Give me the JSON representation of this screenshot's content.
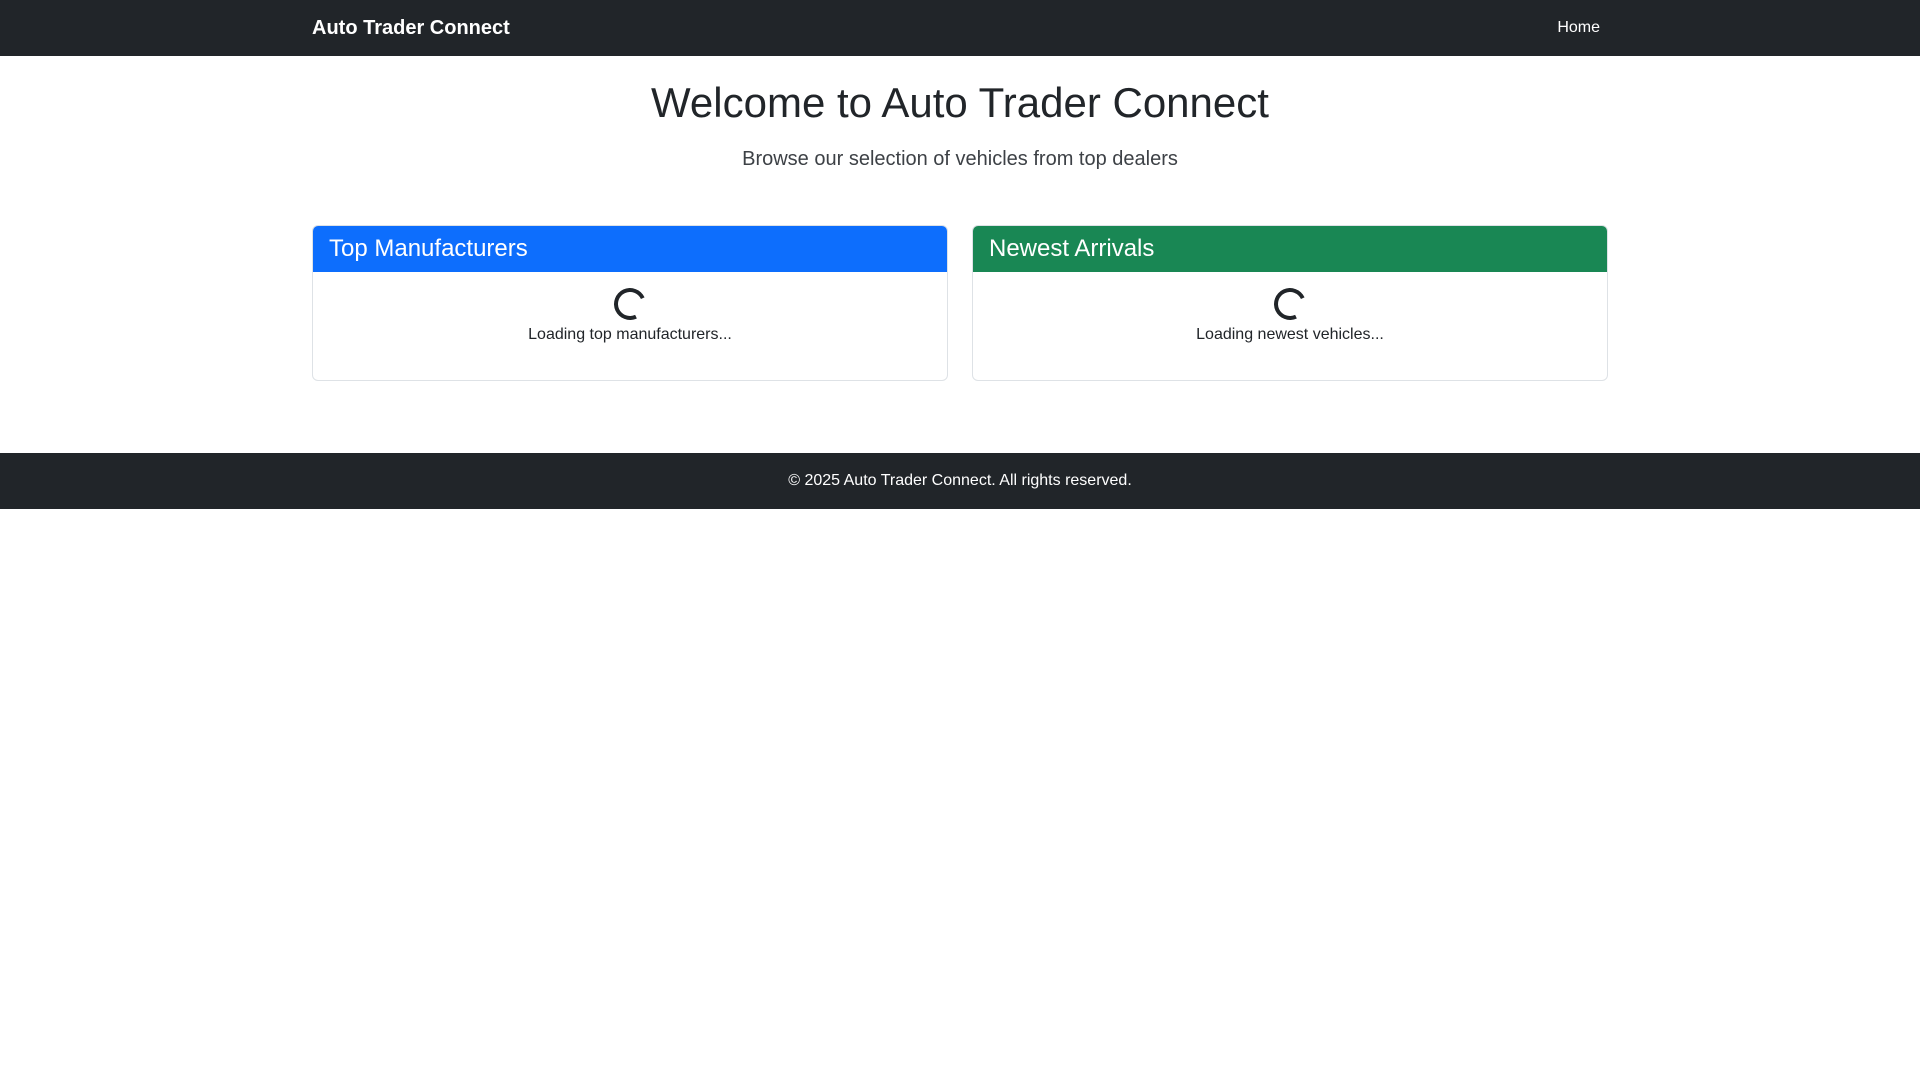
{
  "navbar": {
    "brand": "Auto Trader Connect",
    "links": [
      {
        "label": "Home"
      }
    ]
  },
  "hero": {
    "title": "Welcome to Auto Trader Connect",
    "subtitle": "Browse our selection of vehicles from top dealers"
  },
  "cards": [
    {
      "title": "Top Manufacturers",
      "loading_text": "Loading top manufacturers...",
      "header_color": "#0d6efd"
    },
    {
      "title": "Newest Arrivals",
      "loading_text": "Loading newest vehicles...",
      "header_color": "#198754"
    }
  ],
  "icons": {
    "loading": "spinner-icon"
  },
  "footer": {
    "text": "© 2025 Auto Trader Connect. All rights reserved."
  },
  "colors": {
    "navbar_bg": "#212529",
    "footer_bg": "#212529"
  }
}
